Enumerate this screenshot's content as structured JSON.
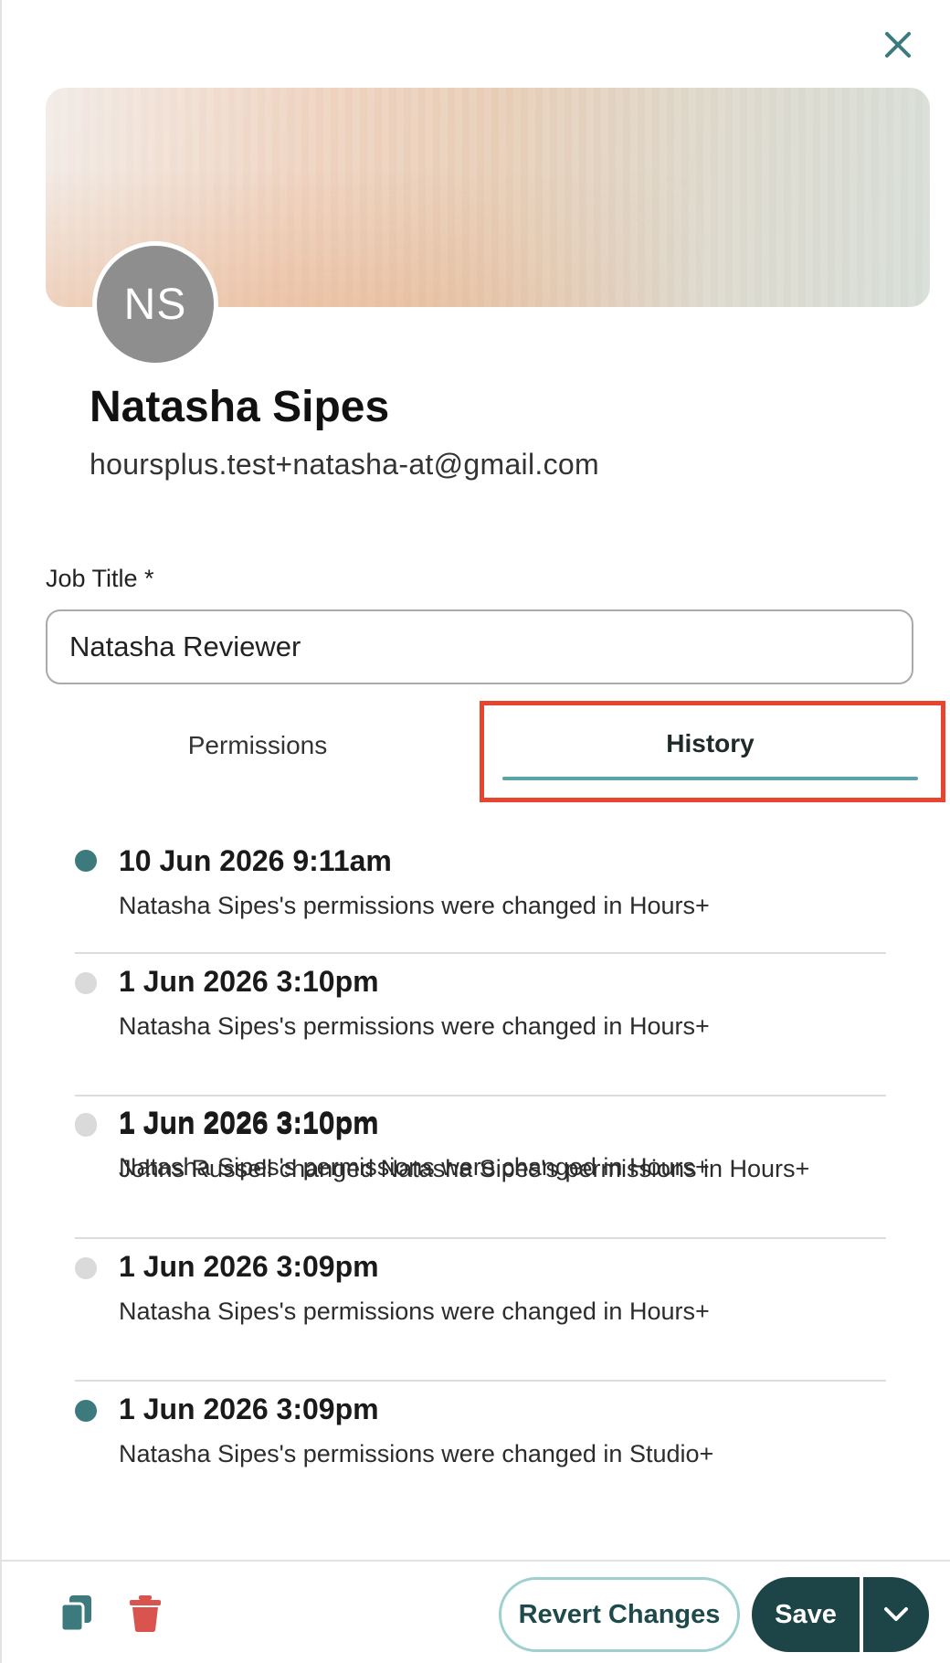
{
  "profile": {
    "initials": "NS",
    "name": "Natasha Sipes",
    "email": "hoursplus.test+natasha-at@gmail.com"
  },
  "job_title": {
    "label": "Job Title *",
    "value": "Natasha Reviewer"
  },
  "tabs": [
    {
      "label": "Permissions",
      "active": false
    },
    {
      "label": "History",
      "active": true
    }
  ],
  "history": [
    {
      "date": "10 Jun 2026 9:11am",
      "description": "Natasha Sipes's permissions were changed in Hours+",
      "status": "active"
    },
    {
      "date": "1 Jun 2026 3:10pm",
      "description": "Natasha Sipes's permissions were changed in Hours+",
      "status": "inactive"
    },
    {
      "date": "1 Jun 2026 3:10pm",
      "description": "Johns Russell changed Natasha Sipes's permissions in Hours+",
      "status": "inactive"
    },
    {
      "date": "1 Jun 2026 3:09pm",
      "description": "Natasha Sipes's permissions were changed in Hours+",
      "status": "inactive"
    },
    {
      "date": "1 Jun 2026 3:09pm",
      "description": "Natasha Sipes's permissions were changed in Studio+",
      "status": "active"
    }
  ],
  "footer": {
    "revert_label": "Revert Changes",
    "save_label": "Save"
  },
  "icons": {
    "close": "close-icon",
    "copy": "copy-icon",
    "delete": "trash-icon",
    "dropdown": "chevron-down-icon"
  },
  "colors": {
    "accent": "#3c7a7e",
    "primary_button": "#1d4446",
    "tab_underline": "#5aa3a6",
    "highlight": "#e8452f",
    "danger": "#d9534f"
  }
}
